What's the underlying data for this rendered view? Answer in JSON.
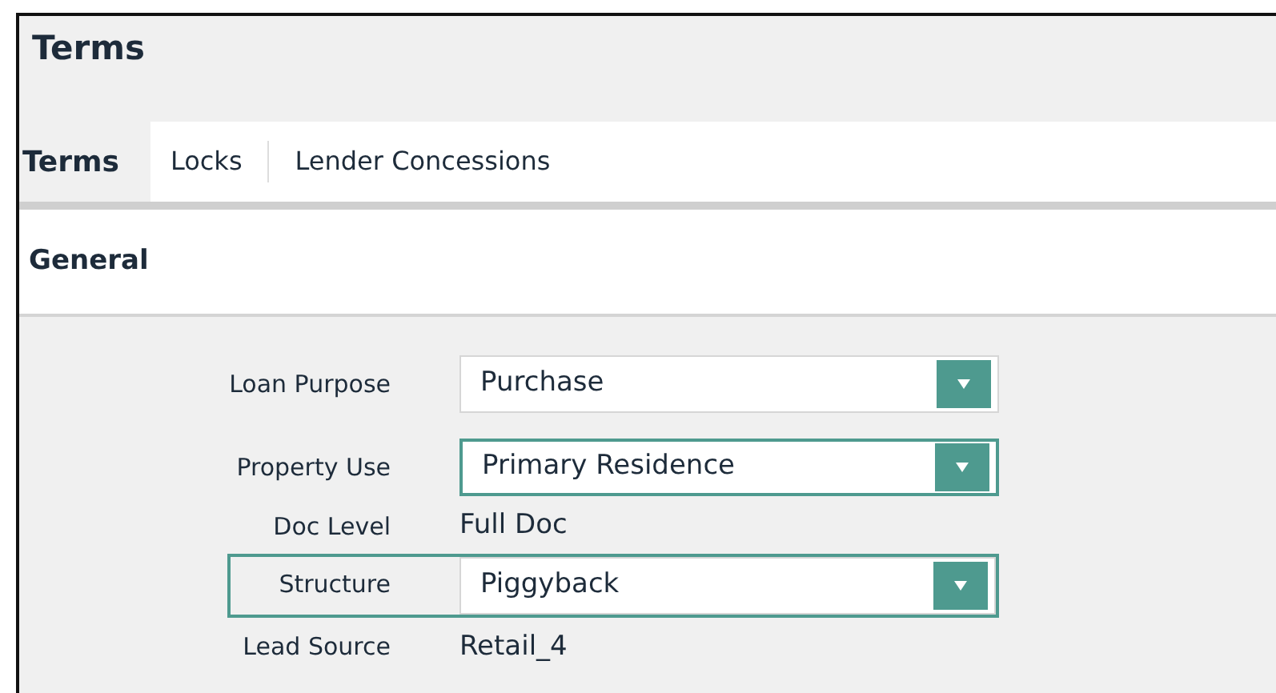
{
  "panel": {
    "title": "Terms"
  },
  "tabs": [
    {
      "label": "Terms",
      "selected": true
    },
    {
      "label": "Locks",
      "selected": false
    },
    {
      "label": "Lender Concessions",
      "selected": false
    }
  ],
  "section": {
    "title": "General"
  },
  "fields": [
    {
      "label": "Loan Purpose",
      "kind": "select",
      "value": "Purchase",
      "focused": false,
      "highlighted": false
    },
    {
      "label": "Property Use",
      "kind": "select",
      "value": "Primary Residence",
      "focused": true,
      "highlighted": false
    },
    {
      "label": "Doc Level",
      "kind": "text",
      "value": "Full Doc",
      "highlighted": false
    },
    {
      "label": "Structure",
      "kind": "select",
      "value": "Piggyback",
      "focused": false,
      "highlighted": true
    },
    {
      "label": "Lead Source",
      "kind": "text",
      "value": "Retail_4",
      "highlighted": false
    }
  ]
}
